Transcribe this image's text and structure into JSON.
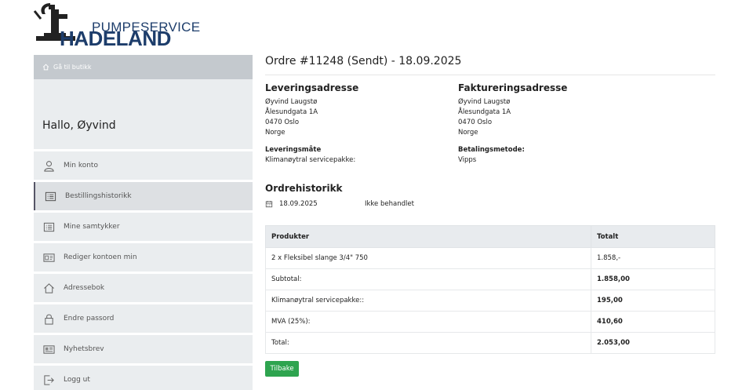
{
  "brand": {
    "top": "PUMPESERVICE",
    "bottom": "HADELAND",
    "color": "#1d3d6b"
  },
  "sidebar": {
    "back_label": "Gå til butikk",
    "greeting": "Hallo, Øyvind",
    "items": [
      {
        "label": "Min konto",
        "icon": "user-icon"
      },
      {
        "label": "Bestillingshistorikk",
        "icon": "list-icon",
        "active": true
      },
      {
        "label": "Mine samtykker",
        "icon": "list-icon"
      },
      {
        "label": "Rediger kontoen min",
        "icon": "id-card-icon"
      },
      {
        "label": "Adressebok",
        "icon": "home-icon"
      },
      {
        "label": "Endre passord",
        "icon": "lock-icon"
      },
      {
        "label": "Nyhetsbrev",
        "icon": "newspaper-icon"
      },
      {
        "label": "Logg ut",
        "icon": "logout-icon"
      }
    ]
  },
  "order": {
    "title": "Ordre #11248 (Sendt) - 18.09.2025",
    "shipping": {
      "heading": "Leveringsadresse",
      "lines": [
        "Øyvind Laugstø",
        "Ålesundgata 1A",
        "0470 Oslo",
        "Norge"
      ],
      "method_label": "Leveringsmåte",
      "method_value": "Klimanøytral servicepakke:"
    },
    "billing": {
      "heading": "Faktureringsadresse",
      "lines": [
        "Øyvind Laugstø",
        "Ålesundgata 1A",
        "0470 Oslo",
        "Norge"
      ],
      "method_label": "Betalingsmetode:",
      "method_value": "Vipps"
    },
    "history": {
      "heading": "Ordrehistorikk",
      "date": "18.09.2025",
      "status": "Ikke behandlet"
    },
    "table": {
      "headers": [
        "Produkter",
        "Totalt"
      ],
      "rows": [
        {
          "label": "2 x Fleksibel slange 3/4\" 750",
          "value": "1.858,-",
          "bold": false
        },
        {
          "label": "Subtotal:",
          "value": "1.858,00",
          "bold": true
        },
        {
          "label": "Klimanøytral servicepakke::",
          "value": "195,00",
          "bold": true
        },
        {
          "label": "MVA (25%):",
          "value": "410,60",
          "bold": true
        },
        {
          "label": "Total:",
          "value": "2.053,00",
          "bold": true
        }
      ]
    },
    "back_button": "Tilbake",
    "button_color": "#2ea44f"
  }
}
